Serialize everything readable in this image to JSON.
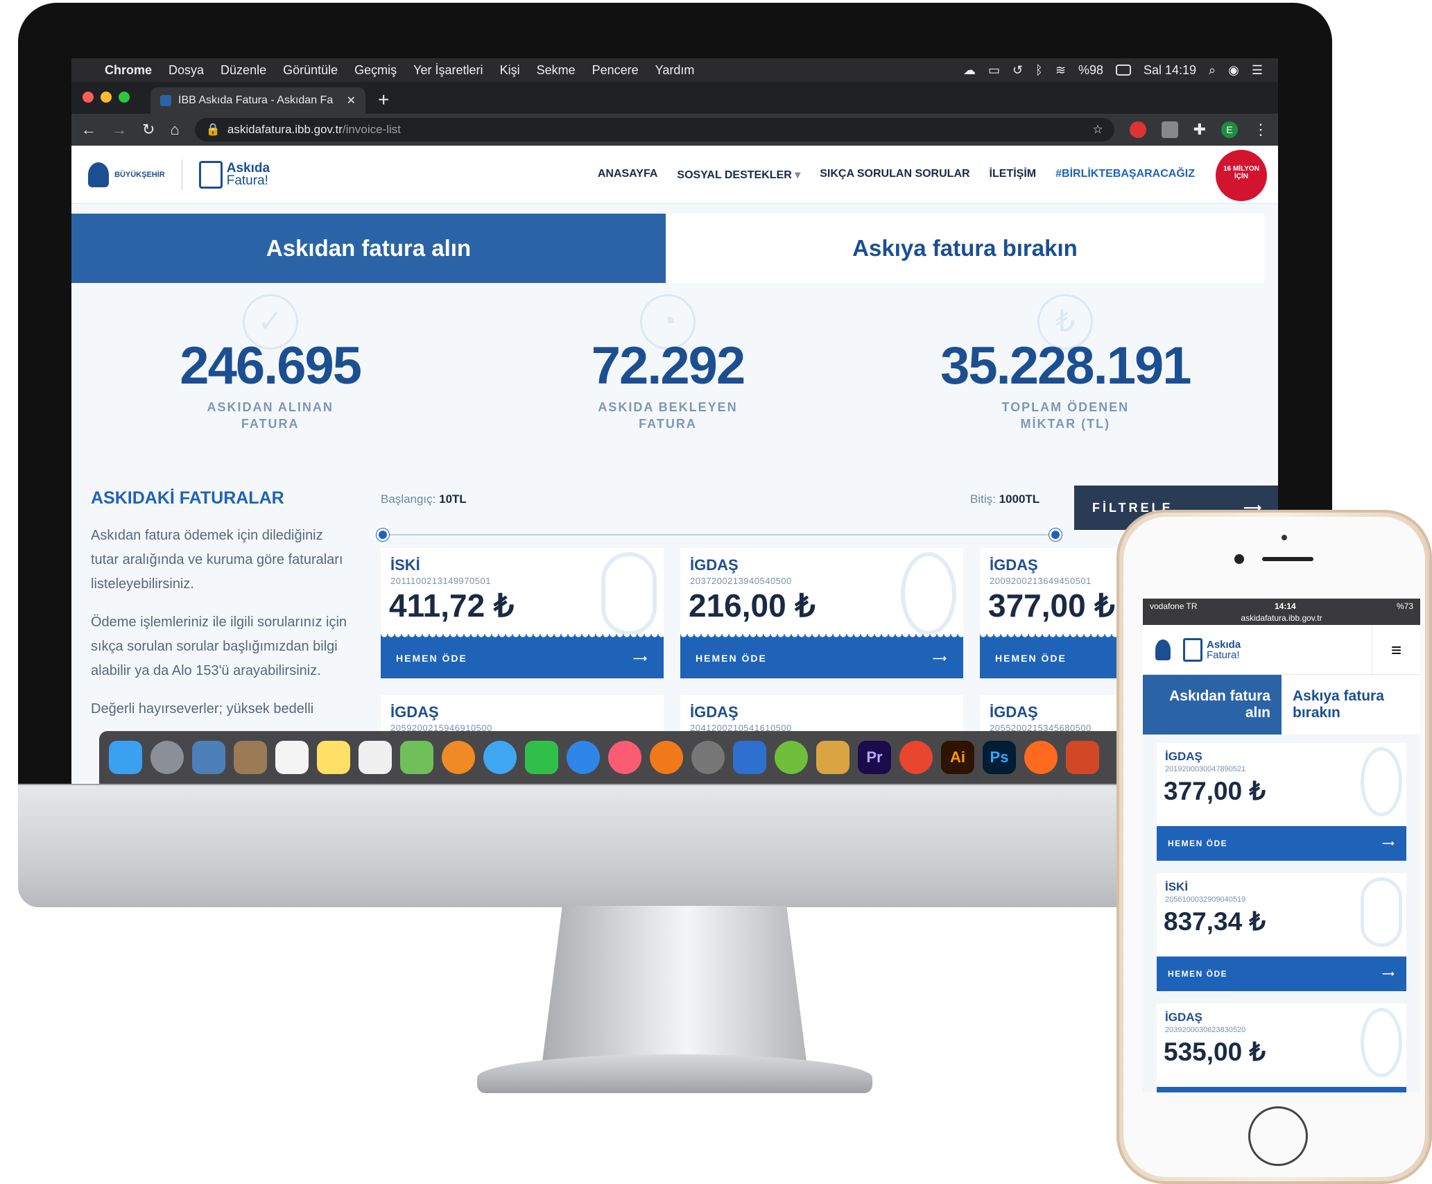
{
  "menubar": {
    "items": [
      "Chrome",
      "Dosya",
      "Düzenle",
      "Görüntüle",
      "Geçmiş",
      "Yer İşaretleri",
      "Kişi",
      "Sekme",
      "Pencere",
      "Yardım"
    ],
    "battery": "%98",
    "clock": "Sal 14:19"
  },
  "browser": {
    "tab_title": "İBB Askıda Fatura - Askıdan Fa",
    "url_host": "askidafatura.ibb.gov.tr",
    "url_path": "/invoice-list",
    "profile_letter": "E"
  },
  "site": {
    "logo_ibb": "BÜYÜKŞEHİR",
    "logo_askida_top": "Askıda",
    "logo_askida_bottom": "Fatura!",
    "nav": [
      "ANASAYFA",
      "SOSYAL DESTEKLER",
      "SIKÇA SORULAN SORULAR",
      "İLETİŞİM",
      "#BİRLİKTEBAŞARACAĞIZ"
    ],
    "badge_text": "16 MİLYON İÇİN"
  },
  "mode_tabs": {
    "take": "Askıdan fatura alın",
    "leave": "Askıya fatura bırakın"
  },
  "stats": [
    {
      "value": "246.695",
      "label_1": "ASKIDAN ALINAN",
      "label_2": "FATURA"
    },
    {
      "value": "72.292",
      "label_1": "ASKIDA BEKLEYEN",
      "label_2": "FATURA"
    },
    {
      "value": "35.228.191",
      "label_1": "TOPLAM ÖDENEN",
      "label_2": "MİKTAR (TL)"
    }
  ],
  "left_panel": {
    "title": "ASKIDAKİ FATURALAR",
    "p1": "Askıdan fatura ödemek için dilediğiniz tutar aralığında ve kuruma göre faturaları listeleyebilirsiniz.",
    "p2": "Ödeme işlemleriniz ile ilgili sorularınız için sıkça sorulan sorular başlığımızdan bilgi alabilir ya da Alo 153'ü arayabilirsiniz.",
    "p3": "Değerli hayırseverler; yüksek bedelli"
  },
  "filter": {
    "start_label": "Başlangıç:",
    "start_value": "10TL",
    "end_label": "Bitiş:",
    "end_value": "1000TL",
    "button": "FİLTRELE"
  },
  "pay_label": "HEMEN ÖDE",
  "bills": [
    {
      "inst": "İSKİ",
      "code": "2011100213149970501",
      "amount": "411,72 ₺"
    },
    {
      "inst": "İGDAŞ",
      "code": "2037200213940540500",
      "amount": "216,00 ₺"
    },
    {
      "inst": "İGDAŞ",
      "code": "2009200213649450501",
      "amount": "377,00 ₺"
    },
    {
      "inst": "İGDAŞ",
      "code": "2059200215946910500",
      "amount": ""
    },
    {
      "inst": "İGDAŞ",
      "code": "2041200210541610500",
      "amount": ""
    },
    {
      "inst": "İGDAŞ",
      "code": "2055200215345680500",
      "amount": ""
    }
  ],
  "phone": {
    "carrier": "vodafone TR",
    "time": "14:14",
    "battery": "%73",
    "url": "askidafatura.ibb.gov.tr",
    "tab_take": "Askıdan fatura alın",
    "tab_leave": "Askıya fatura bırakın",
    "bills": [
      {
        "inst": "İGDAŞ",
        "code": "2019200030047890521",
        "amount": "377,00 ₺"
      },
      {
        "inst": "İSKİ",
        "code": "2056100032909040519",
        "amount": "837,34 ₺"
      },
      {
        "inst": "İGDAŞ",
        "code": "2039200030623830520",
        "amount": "535,00 ₺"
      }
    ]
  },
  "dock_apps": [
    "Pr",
    "Ai",
    "Ps"
  ]
}
